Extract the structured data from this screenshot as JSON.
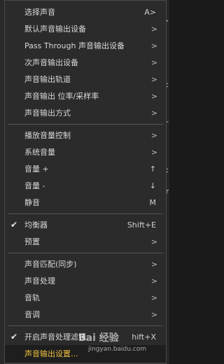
{
  "menu": {
    "items": [
      {
        "label": "选择声音",
        "shortcut": "A>"
      },
      {
        "label": "默认声音输出设备",
        "arrow": ">"
      },
      {
        "label": "Pass Through 声音输出设备",
        "arrow": ">"
      },
      {
        "label": "次声音输出设备",
        "arrow": ">"
      },
      {
        "label": "声音输出轨道",
        "arrow": ">"
      },
      {
        "label": "声音输出 位率/采样率",
        "arrow": ">"
      },
      {
        "label": "声音输出方式",
        "arrow": ">"
      },
      {
        "label": "播放音量控制",
        "arrow": ">"
      },
      {
        "label": "系统音量",
        "arrow": ">"
      },
      {
        "label": "音量 +",
        "shortcut": "↑"
      },
      {
        "label": "音量 -",
        "shortcut": "↓"
      },
      {
        "label": "静音",
        "shortcut": "M"
      },
      {
        "label": "均衡器",
        "shortcut": "Shift+E",
        "checked": "✔"
      },
      {
        "label": "预置",
        "arrow": ">"
      },
      {
        "label": "声音匹配(同步)",
        "arrow": ">"
      },
      {
        "label": "声音处理",
        "arrow": ">"
      },
      {
        "label": "音轨",
        "arrow": ">"
      },
      {
        "label": "音调",
        "arrow": ">"
      },
      {
        "label": "开启声音处理滤镜",
        "shortcut": "hift+X",
        "checked": "✔"
      },
      {
        "label": "声音输出设置..."
      }
    ]
  },
  "watermark": {
    "logo": "Bai 经验",
    "url": "jingyan.baidu.com"
  },
  "background": {
    "right_glyphs": [
      ">",
      "<",
      "-",
      "<",
      "r"
    ]
  }
}
